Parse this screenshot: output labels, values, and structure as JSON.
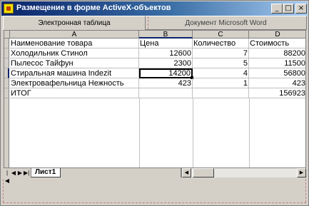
{
  "window": {
    "title": "Размещение в форме ActiveX-объектов",
    "minimize_label": "_",
    "maximize_label": "□",
    "close_label": "×"
  },
  "tabs": [
    {
      "label": "Электронная таблица",
      "active": true
    },
    {
      "label": "Документ Microsoft Word",
      "active": false
    }
  ],
  "sheet": {
    "columns": [
      "A",
      "B",
      "C",
      "D"
    ],
    "rows": [
      [
        "Наименование товара",
        "Цена",
        "Количество",
        "Стоимость"
      ],
      [
        "Холодильник Стинол",
        "12600",
        "7",
        "88200"
      ],
      [
        "Пылесос Тайфун",
        "2300",
        "5",
        "11500"
      ],
      [
        "Стиральная машина Indezit",
        "14200",
        "4",
        "56800"
      ],
      [
        "Электровафельница Нежность",
        "423",
        "1",
        "423"
      ],
      [
        "ИТОГ",
        "",
        "",
        "156923"
      ]
    ],
    "active_cell": "B4",
    "sheet_tab": "Лист1"
  },
  "icons": {
    "app": "app-icon",
    "first": "first-sheet-icon",
    "prev": "prev-sheet-icon",
    "next": "next-sheet-icon",
    "last": "last-sheet-icon"
  },
  "nav": {
    "first": "|◀",
    "prev": "◀",
    "next": "▶",
    "last": "▶|",
    "scroll_left": "◀",
    "scroll_right": "▶"
  },
  "colors": {
    "title_start": "#0a246a",
    "title_end": "#a6caf0",
    "dashed": "#c08080"
  }
}
